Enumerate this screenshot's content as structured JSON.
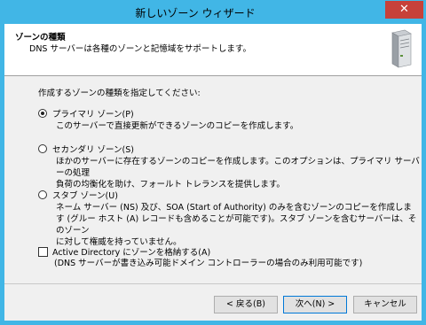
{
  "window": {
    "title": "新しいゾーン ウィザード",
    "close_glyph": "✕"
  },
  "header": {
    "title": "ゾーンの種類",
    "subtitle": "DNS サーバーは各種のゾーンと記憶域をサポートします。"
  },
  "content": {
    "instruction": "作成するゾーンの種類を指定してください:",
    "options": [
      {
        "label": "プライマリ ゾーン(P)",
        "selected": true,
        "desc_lines": [
          "このサーバーで直接更新ができるゾーンのコピーを作成します。"
        ]
      },
      {
        "label": "セカンダリ ゾーン(S)",
        "selected": false,
        "desc_lines": [
          "ほかのサーバーに存在するゾーンのコピーを作成します。このオプションは、プライマリ サーバーの処理",
          "負荷の均衡化を助け、フォールト トレランスを提供します。"
        ]
      },
      {
        "label": "スタブ ゾーン(U)",
        "selected": false,
        "desc_lines": [
          "ネーム サーバー (NS) 及び、SOA (Start of Authority) のみを含むゾーンのコピーを作成しま",
          "す (グルー ホスト (A) レコードも含めることが可能です)。スタブ ゾーンを含むサーバーは、そのゾーン",
          "に対して権威を持っていません。"
        ]
      }
    ],
    "ad_checkbox": {
      "label": "Active Directory にゾーンを格納する(A)",
      "checked": false,
      "note": "(DNS サーバーが書き込み可能ドメイン コントローラーの場合のみ利用可能です)"
    }
  },
  "buttons": {
    "back": "< 戻る(B)",
    "next": "次へ(N) >",
    "cancel": "キャンセル"
  },
  "colors": {
    "title_bar": "#41b6e6",
    "close_button": "#c7413a",
    "dialog_bg": "#f0f0f0"
  }
}
